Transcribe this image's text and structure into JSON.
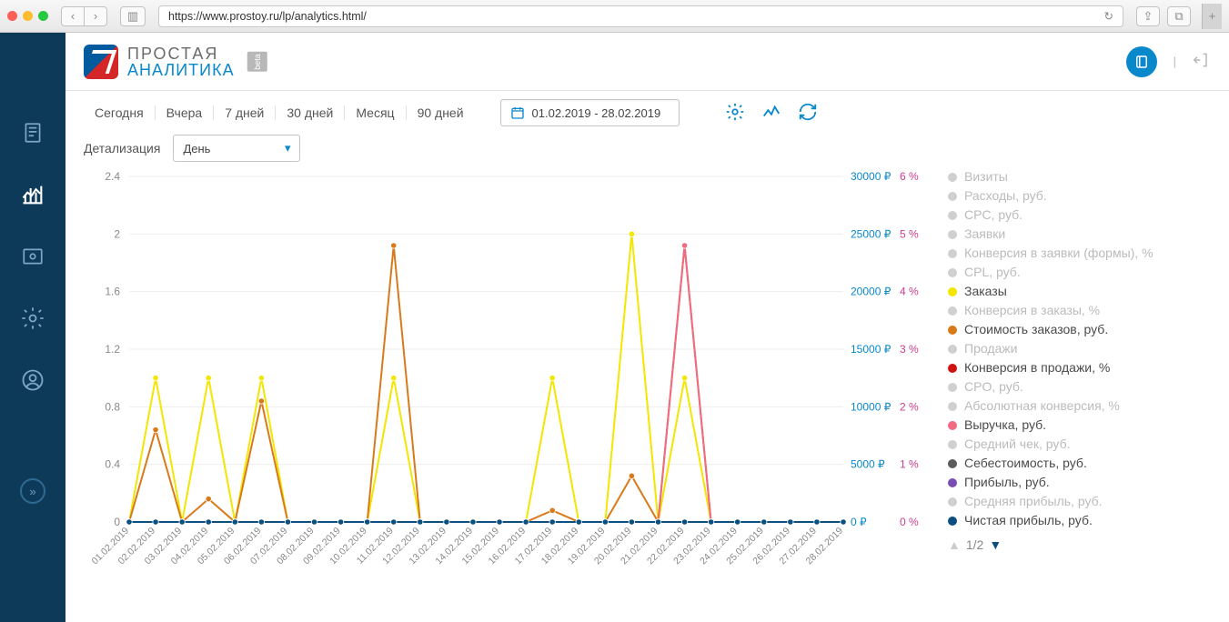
{
  "browser": {
    "url": "https://www.prostoy.ru/lp/analytics.html/"
  },
  "brand": {
    "line1": "ПРОСТАЯ",
    "line2": "АНАЛИТИКА",
    "badge": "beta"
  },
  "periods": [
    "Сегодня",
    "Вчера",
    "7 дней",
    "30 дней",
    "Месяц",
    "90 дней"
  ],
  "date_range": "01.02.2019 - 28.02.2019",
  "detail_label": "Детализация",
  "detail_value": "День",
  "pager": "1/2",
  "legend": [
    {
      "label": "Визиты",
      "color": "#c9c9c9",
      "off": true
    },
    {
      "label": "Расходы, руб.",
      "color": "#c9c9c9",
      "off": true
    },
    {
      "label": "CPC, руб.",
      "color": "#c9c9c9",
      "off": true
    },
    {
      "label": "Заявки",
      "color": "#c9c9c9",
      "off": true
    },
    {
      "label": "Конверсия в заявки (формы), %",
      "color": "#c9c9c9",
      "off": true
    },
    {
      "label": "CPL, руб.",
      "color": "#c9c9c9",
      "off": true
    },
    {
      "label": "Заказы",
      "color": "#f3e600",
      "off": false
    },
    {
      "label": "Конверсия в заказы, %",
      "color": "#c9c9c9",
      "off": true
    },
    {
      "label": "Стоимость заказов, руб.",
      "color": "#d97a1a",
      "off": false
    },
    {
      "label": "Продажи",
      "color": "#c9c9c9",
      "off": true
    },
    {
      "label": "Конверсия в продажи, %",
      "color": "#cf1313",
      "off": false
    },
    {
      "label": "CPO, руб.",
      "color": "#c9c9c9",
      "off": true
    },
    {
      "label": "Абсолютная конверсия, %",
      "color": "#c9c9c9",
      "off": true
    },
    {
      "label": "Выручка, руб.",
      "color": "#f16a83",
      "off": false
    },
    {
      "label": "Средний чек, руб.",
      "color": "#c9c9c9",
      "off": true
    },
    {
      "label": "Себестоимость, руб.",
      "color": "#5b5b5b",
      "off": false
    },
    {
      "label": "Прибыль, руб.",
      "color": "#7a4db3",
      "off": false
    },
    {
      "label": "Средняя прибыль, руб.",
      "color": "#c9c9c9",
      "off": true
    },
    {
      "label": "Чистая прибыль, руб.",
      "color": "#0b4f7e",
      "off": false
    }
  ],
  "chart_data": {
    "type": "line",
    "x": [
      "01.02.2019",
      "02.02.2019",
      "03.02.2019",
      "04.02.2019",
      "05.02.2019",
      "06.02.2019",
      "07.02.2019",
      "08.02.2019",
      "09.02.2019",
      "10.02.2019",
      "11.02.2019",
      "12.02.2019",
      "13.02.2019",
      "14.02.2019",
      "15.02.2019",
      "16.02.2019",
      "17.02.2019",
      "18.02.2019",
      "19.02.2019",
      "20.02.2019",
      "21.02.2019",
      "22.02.2019",
      "23.02.2019",
      "24.02.2019",
      "25.02.2019",
      "26.02.2019",
      "27.02.2019",
      "28.02.2019"
    ],
    "axes": {
      "y_left": {
        "label": "",
        "min": 0,
        "max": 2.4,
        "ticks": [
          0,
          0.4,
          0.8,
          1.2,
          1.6,
          2,
          2.4
        ]
      },
      "y_right1": {
        "label": "₽",
        "min": 0,
        "max": 30000,
        "ticks": [
          0,
          5000,
          10000,
          15000,
          20000,
          25000,
          30000
        ]
      },
      "y_right2": {
        "label": "%",
        "min": 0,
        "max": 6,
        "ticks": [
          0,
          1,
          2,
          3,
          4,
          5,
          6
        ]
      }
    },
    "series": [
      {
        "name": "Заказы",
        "axis": "y_left",
        "color": "#f3e600",
        "values": [
          0,
          1,
          0,
          1,
          0,
          1,
          0,
          0,
          0,
          0,
          1,
          0,
          0,
          0,
          0,
          0,
          1,
          0,
          0,
          2,
          0,
          1,
          0,
          0,
          0,
          0,
          0,
          0
        ]
      },
      {
        "name": "Стоимость заказов, руб.",
        "axis": "y_right1",
        "color": "#d97a1a",
        "values": [
          0,
          8000,
          0,
          2000,
          0,
          10500,
          0,
          0,
          0,
          0,
          24000,
          0,
          0,
          0,
          0,
          0,
          1000,
          0,
          0,
          4000,
          0,
          24000,
          0,
          0,
          0,
          0,
          0,
          0
        ]
      },
      {
        "name": "Конверсия в продажи, %",
        "axis": "y_right2",
        "color": "#cf1313",
        "values": [
          0,
          0,
          0,
          0,
          0,
          0,
          0,
          0,
          0,
          0,
          0,
          0,
          0,
          0,
          0,
          0,
          0,
          0,
          0,
          0,
          0,
          0,
          0,
          0,
          0,
          0,
          0,
          0
        ]
      },
      {
        "name": "Выручка, руб.",
        "axis": "y_right1",
        "color": "#f16a83",
        "values": [
          0,
          0,
          0,
          0,
          0,
          0,
          0,
          0,
          0,
          0,
          0,
          0,
          0,
          0,
          0,
          0,
          0,
          0,
          0,
          0,
          0,
          24000,
          0,
          0,
          0,
          0,
          0,
          0
        ]
      },
      {
        "name": "Себестоимость, руб.",
        "axis": "y_right1",
        "color": "#5b5b5b",
        "values": [
          0,
          0,
          0,
          0,
          0,
          0,
          0,
          0,
          0,
          0,
          0,
          0,
          0,
          0,
          0,
          0,
          0,
          0,
          0,
          0,
          0,
          0,
          0,
          0,
          0,
          0,
          0,
          0
        ]
      },
      {
        "name": "Прибыль, руб.",
        "axis": "y_right1",
        "color": "#7a4db3",
        "values": [
          0,
          0,
          0,
          0,
          0,
          0,
          0,
          0,
          0,
          0,
          0,
          0,
          0,
          0,
          0,
          0,
          0,
          0,
          0,
          0,
          0,
          0,
          0,
          0,
          0,
          0,
          0,
          0
        ]
      },
      {
        "name": "Чистая прибыль, руб.",
        "axis": "y_right1",
        "color": "#0b4f7e",
        "values": [
          0,
          0,
          0,
          0,
          0,
          0,
          0,
          0,
          0,
          0,
          0,
          0,
          0,
          0,
          0,
          0,
          0,
          0,
          0,
          0,
          0,
          0,
          0,
          0,
          0,
          0,
          0,
          0
        ]
      }
    ]
  }
}
